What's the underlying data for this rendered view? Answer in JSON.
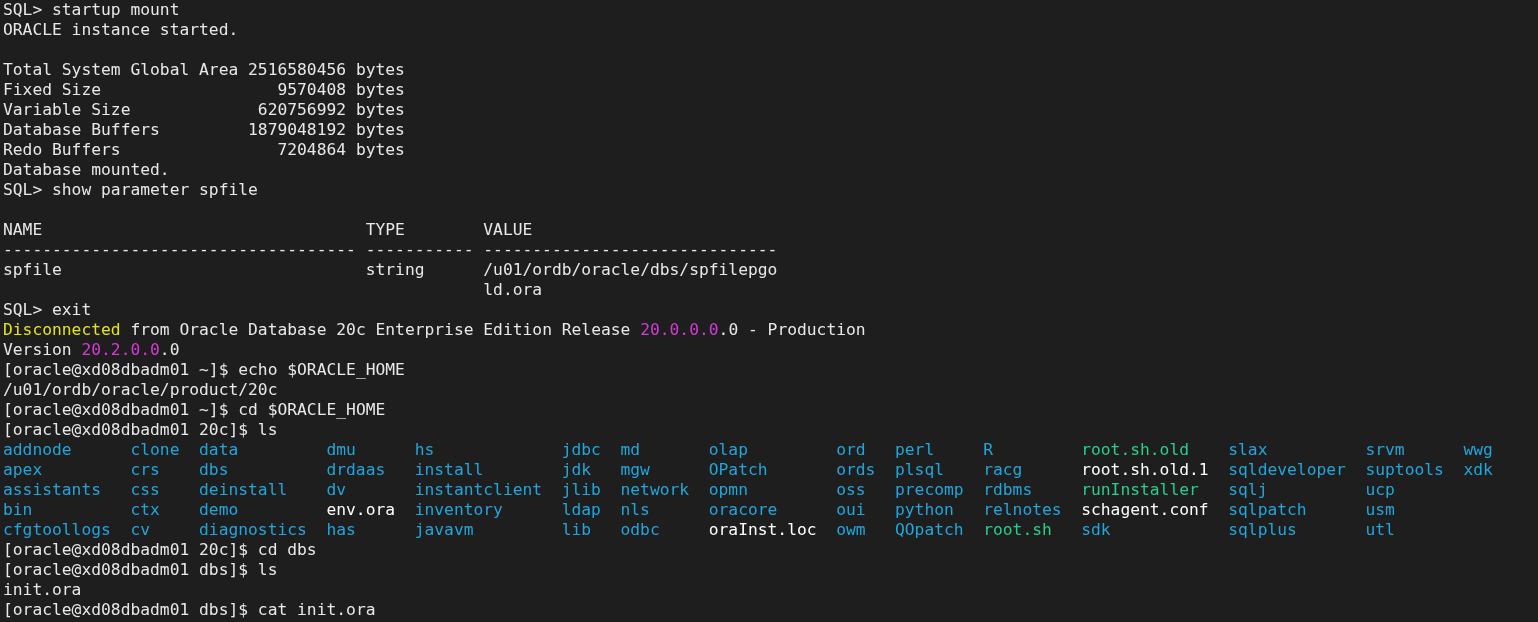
{
  "terminal": {
    "lines": [
      {
        "kind": "text",
        "segments": [
          {
            "text": "SQL> startup mount"
          }
        ]
      },
      {
        "kind": "text",
        "segments": [
          {
            "text": "ORACLE instance started."
          }
        ]
      },
      {
        "kind": "blank"
      },
      {
        "kind": "text",
        "segments": [
          {
            "text": "Total System Global Area 2516580456 bytes"
          }
        ]
      },
      {
        "kind": "text",
        "segments": [
          {
            "text": "Fixed Size                  9570408 bytes"
          }
        ]
      },
      {
        "kind": "text",
        "segments": [
          {
            "text": "Variable Size             620756992 bytes"
          }
        ]
      },
      {
        "kind": "text",
        "segments": [
          {
            "text": "Database Buffers         1879048192 bytes"
          }
        ]
      },
      {
        "kind": "text",
        "segments": [
          {
            "text": "Redo Buffers                7204864 bytes"
          }
        ]
      },
      {
        "kind": "text",
        "segments": [
          {
            "text": "Database mounted."
          }
        ]
      },
      {
        "kind": "text",
        "segments": [
          {
            "text": "SQL> show parameter spfile"
          }
        ]
      },
      {
        "kind": "blank"
      },
      {
        "kind": "table",
        "columns": [
          {
            "heading": "NAME",
            "rule": "------------------------------------"
          },
          {
            "heading": "TYPE",
            "rule": "-----------"
          },
          {
            "heading": "VALUE",
            "rule": "------------------------------"
          }
        ],
        "rows": [
          {
            "cells": [
              [
                "spfile"
              ],
              [
                "string"
              ],
              [
                "/u01/ordb/oracle/dbs/spfilepgo",
                "ld.ora"
              ]
            ]
          }
        ]
      },
      {
        "kind": "text",
        "segments": [
          {
            "text": "SQL> exit"
          }
        ]
      },
      {
        "kind": "text",
        "segments": [
          {
            "text": "Disconnected",
            "color": "#e5e510"
          },
          {
            "text": " from Oracle Database 20c Enterprise Edition Release "
          },
          {
            "text": "20.0.0.0",
            "color": "#d63ad6"
          },
          {
            "text": ".0 - Production"
          }
        ]
      },
      {
        "kind": "text",
        "segments": [
          {
            "text": "Version "
          },
          {
            "text": "20.2.0.0",
            "color": "#d63ad6"
          },
          {
            "text": ".0"
          }
        ]
      },
      {
        "kind": "text",
        "segments": [
          {
            "text": "[oracle@xd08dbadm01 ~]$ echo $ORACLE_HOME"
          }
        ]
      },
      {
        "kind": "text",
        "segments": [
          {
            "text": "/u01/ordb/oracle/product/20c"
          }
        ]
      },
      {
        "kind": "text",
        "segments": [
          {
            "text": "[oracle@xd08dbadm01 ~]$ cd $ORACLE_HOME"
          }
        ]
      },
      {
        "kind": "text",
        "segments": [
          {
            "text": "[oracle@xd08dbadm01 20c]$ ls"
          }
        ]
      },
      {
        "kind": "listing",
        "columns": [
          [
            {
              "name": "addnode",
              "color": "#1fa6dd"
            },
            {
              "name": "apex",
              "color": "#1fa6dd"
            },
            {
              "name": "assistants",
              "color": "#1fa6dd"
            },
            {
              "name": "bin",
              "color": "#1fa6dd"
            },
            {
              "name": "cfgtoollogs",
              "color": "#1fa6dd"
            }
          ],
          [
            {
              "name": "clone",
              "color": "#1fa6dd"
            },
            {
              "name": "crs",
              "color": "#1fa6dd"
            },
            {
              "name": "css",
              "color": "#1fa6dd"
            },
            {
              "name": "ctx",
              "color": "#1fa6dd"
            },
            {
              "name": "cv",
              "color": "#1fa6dd"
            }
          ],
          [
            {
              "name": "data",
              "color": "#1fa6dd"
            },
            {
              "name": "dbs",
              "color": "#1fa6dd"
            },
            {
              "name": "deinstall",
              "color": "#1fa6dd"
            },
            {
              "name": "demo",
              "color": "#1fa6dd"
            },
            {
              "name": "diagnostics",
              "color": "#1fa6dd"
            }
          ],
          [
            {
              "name": "dmu",
              "color": "#1fa6dd"
            },
            {
              "name": "drdaas",
              "color": "#1fa6dd"
            },
            {
              "name": "dv",
              "color": "#1fa6dd"
            },
            {
              "name": "env.ora",
              "color": "#ffffff"
            },
            {
              "name": "has",
              "color": "#1fa6dd"
            }
          ],
          [
            {
              "name": "hs",
              "color": "#1fa6dd"
            },
            {
              "name": "install",
              "color": "#1fa6dd"
            },
            {
              "name": "instantclient",
              "color": "#1fa6dd"
            },
            {
              "name": "inventory",
              "color": "#1fa6dd"
            },
            {
              "name": "javavm",
              "color": "#1fa6dd"
            }
          ],
          [
            {
              "name": "jdbc",
              "color": "#1fa6dd"
            },
            {
              "name": "jdk",
              "color": "#1fa6dd"
            },
            {
              "name": "jlib",
              "color": "#1fa6dd"
            },
            {
              "name": "ldap",
              "color": "#1fa6dd"
            },
            {
              "name": "lib",
              "color": "#1fa6dd"
            }
          ],
          [
            {
              "name": "md",
              "color": "#1fa6dd"
            },
            {
              "name": "mgw",
              "color": "#1fa6dd"
            },
            {
              "name": "network",
              "color": "#1fa6dd"
            },
            {
              "name": "nls",
              "color": "#1fa6dd"
            },
            {
              "name": "odbc",
              "color": "#1fa6dd"
            }
          ],
          [
            {
              "name": "olap",
              "color": "#1fa6dd"
            },
            {
              "name": "OPatch",
              "color": "#1fa6dd"
            },
            {
              "name": "opmn",
              "color": "#1fa6dd"
            },
            {
              "name": "oracore",
              "color": "#1fa6dd"
            },
            {
              "name": "oraInst.loc",
              "color": "#ffffff"
            }
          ],
          [
            {
              "name": "ord",
              "color": "#1fa6dd"
            },
            {
              "name": "ords",
              "color": "#1fa6dd"
            },
            {
              "name": "oss",
              "color": "#1fa6dd"
            },
            {
              "name": "oui",
              "color": "#1fa6dd"
            },
            {
              "name": "owm",
              "color": "#1fa6dd"
            }
          ],
          [
            {
              "name": "perl",
              "color": "#1fa6dd"
            },
            {
              "name": "plsql",
              "color": "#1fa6dd"
            },
            {
              "name": "precomp",
              "color": "#1fa6dd"
            },
            {
              "name": "python",
              "color": "#1fa6dd"
            },
            {
              "name": "QOpatch",
              "color": "#1fa6dd"
            }
          ],
          [
            {
              "name": "R",
              "color": "#1fa6dd"
            },
            {
              "name": "racg",
              "color": "#1fa6dd"
            },
            {
              "name": "rdbms",
              "color": "#1fa6dd"
            },
            {
              "name": "relnotes",
              "color": "#1fa6dd"
            },
            {
              "name": "root.sh",
              "color": "#23d18b"
            }
          ],
          [
            {
              "name": "root.sh.old",
              "color": "#23d18b"
            },
            {
              "name": "root.sh.old.1",
              "color": "#ffffff"
            },
            {
              "name": "runInstaller",
              "color": "#23d18b"
            },
            {
              "name": "schagent.conf",
              "color": "#ffffff"
            },
            {
              "name": "sdk",
              "color": "#1fa6dd"
            }
          ],
          [
            {
              "name": "slax",
              "color": "#1fa6dd"
            },
            {
              "name": "sqldeveloper",
              "color": "#1fa6dd"
            },
            {
              "name": "sqlj",
              "color": "#1fa6dd"
            },
            {
              "name": "sqlpatch",
              "color": "#1fa6dd"
            },
            {
              "name": "sqlplus",
              "color": "#1fa6dd"
            }
          ],
          [
            {
              "name": "srvm",
              "color": "#1fa6dd"
            },
            {
              "name": "suptools",
              "color": "#1fa6dd"
            },
            {
              "name": "ucp",
              "color": "#1fa6dd"
            },
            {
              "name": "usm",
              "color": "#1fa6dd"
            },
            {
              "name": "utl",
              "color": "#1fa6dd"
            }
          ],
          [
            {
              "name": "wwg",
              "color": "#1fa6dd"
            },
            {
              "name": "xdk",
              "color": "#1fa6dd"
            }
          ]
        ]
      },
      {
        "kind": "text",
        "segments": [
          {
            "text": "[oracle@xd08dbadm01 20c]$ cd dbs"
          }
        ]
      },
      {
        "kind": "text",
        "segments": [
          {
            "text": "[oracle@xd08dbadm01 dbs]$ ls"
          }
        ]
      },
      {
        "kind": "text",
        "segments": [
          {
            "text": "init.ora"
          }
        ]
      },
      {
        "kind": "text",
        "segments": [
          {
            "text": "[oracle@xd08dbadm01 dbs]$ cat init.ora"
          }
        ]
      }
    ]
  }
}
